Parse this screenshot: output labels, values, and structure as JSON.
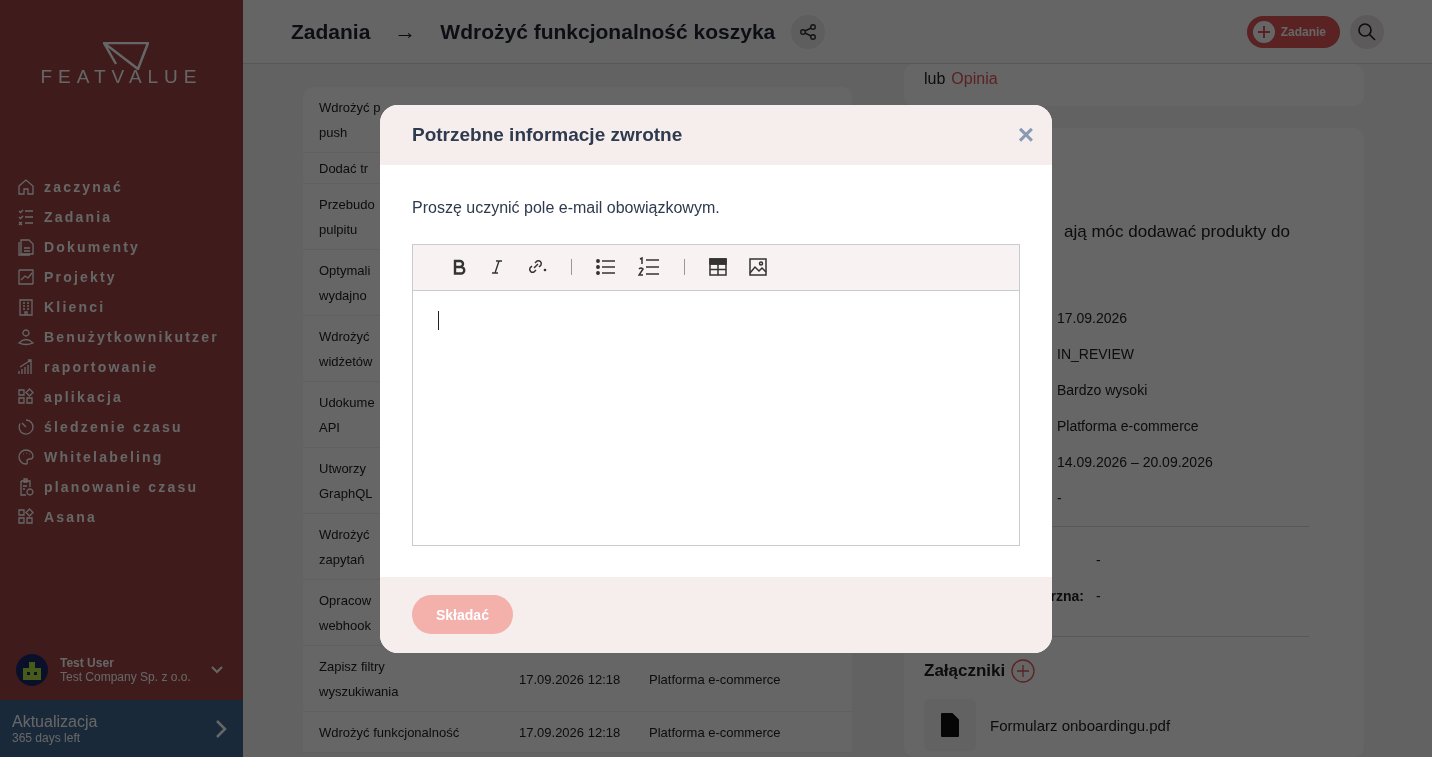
{
  "sidebar": {
    "logo": "FEATVALUE",
    "items": [
      {
        "label": "zaczynać",
        "kind": "home"
      },
      {
        "label": "Zadania",
        "kind": "tasks"
      },
      {
        "label": "Dokumenty",
        "kind": "document"
      },
      {
        "label": "Projekty",
        "kind": "chart"
      },
      {
        "label": "Klienci",
        "kind": "building"
      },
      {
        "label": "Benużytkownikutzer",
        "kind": "user"
      },
      {
        "label": "raportowanie",
        "kind": "bars"
      },
      {
        "label": "aplikacja",
        "kind": "apps"
      },
      {
        "label": "śledzenie czasu",
        "kind": "timer"
      },
      {
        "label": "Whitelabeling",
        "kind": "palette"
      },
      {
        "label": "planowanie czasu",
        "kind": "clipboard"
      },
      {
        "label": "Asana",
        "kind": "apps"
      }
    ],
    "user": {
      "name": "Test User",
      "company": "Test Company Sp. z o.o."
    },
    "upgrade": {
      "title": "Aktualizacja",
      "subtitle": "365 days left"
    }
  },
  "header": {
    "breadcrumb": "Zadania",
    "separator": "→",
    "title": "Wdrożyć funkcjonalność koszyka",
    "new_button": "Zadanie"
  },
  "table": {
    "rows": [
      {
        "task": "Wdrożyć p\npush"
      },
      {
        "task": "Dodać tr"
      },
      {
        "task": "Przebudo\npulpitu"
      },
      {
        "task": "Optymali\nwydajno"
      },
      {
        "task": "Wdrożyć\nwidżetów"
      },
      {
        "task": "Udokume\nAPI"
      },
      {
        "task": "Utworzy\nGraphQL"
      },
      {
        "task": "Wdrożyć\nzapytań"
      },
      {
        "task": "Opracow\nwebhook"
      },
      {
        "task": "Zapisz filtry\nwyszukiwania",
        "created": "17.09.2026 12:18",
        "project": "Platforma e-commerce"
      },
      {
        "task": "Wdrożyć funkcjonalność",
        "created": "17.09.2026 12:18",
        "project": "Platforma e-commerce"
      }
    ]
  },
  "detail": {
    "feedback_prefix": "lub",
    "feedback_link": "Opinia",
    "description": "ają móc dodawać produkty do",
    "fields": [
      "17.09.2026",
      "IN_REVIEW",
      "Bardzo wysoki",
      "Platforma e-commerce",
      "14.09.2026 – 20.09.2026",
      "-"
    ],
    "extra_fields": [
      {
        "value": "-"
      },
      {
        "label": "rzna:",
        "value": "-"
      }
    ],
    "attachments_title": "Załączniki",
    "attachments": [
      "Formularz onboardingu.pdf"
    ]
  },
  "modal": {
    "title": "Potrzebne informacje zwrotne",
    "close": "×",
    "message": "Proszę uczynić pole e-mail obowiązkowym.",
    "toolbar": [
      {
        "kind": "bold"
      },
      {
        "kind": "italic"
      },
      {
        "kind": "link"
      },
      {
        "kind": "separator"
      },
      {
        "kind": "bullets"
      },
      {
        "kind": "numbers"
      },
      {
        "kind": "separator"
      },
      {
        "kind": "table"
      },
      {
        "kind": "image"
      }
    ],
    "submit": "Składać",
    "submit_disabled": true
  }
}
